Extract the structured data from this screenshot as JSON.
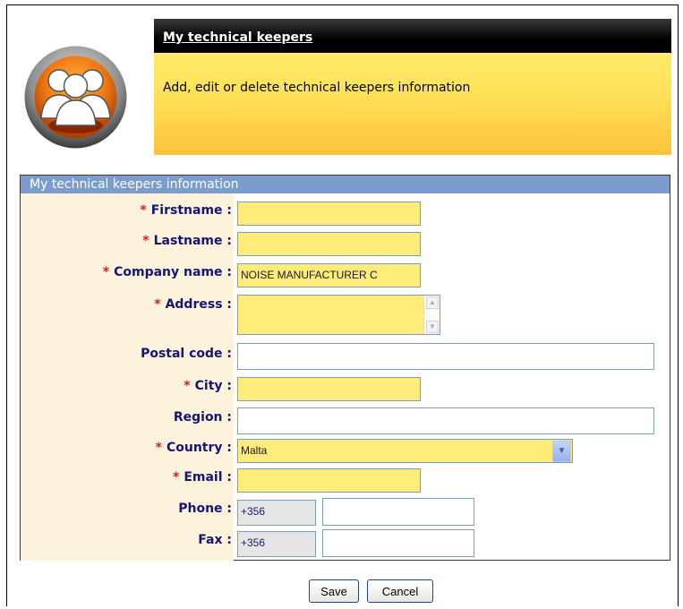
{
  "header": {
    "title": "My technical keepers",
    "description": "Add, edit or delete technical keepers information"
  },
  "panel": {
    "caption": "My technical keepers information"
  },
  "form": {
    "required_mark": "*",
    "firstname": {
      "label": "Firstname :",
      "value": ""
    },
    "lastname": {
      "label": "Lastname :",
      "value": ""
    },
    "company": {
      "label": "Company name :",
      "value": "NOISE MANUFACTURER C"
    },
    "address": {
      "label": "Address :",
      "value": ""
    },
    "postal_code": {
      "label": "Postal code :",
      "value": ""
    },
    "city": {
      "label": "City :",
      "value": ""
    },
    "region": {
      "label": "Region :",
      "value": ""
    },
    "country": {
      "label": "Country :",
      "value": "Malta"
    },
    "email": {
      "label": "Email :",
      "value": ""
    },
    "phone": {
      "label": "Phone :",
      "prefix": "+356",
      "value": ""
    },
    "fax": {
      "label": "Fax :",
      "prefix": "+356",
      "value": ""
    }
  },
  "buttons": {
    "save": "Save",
    "cancel": "Cancel"
  },
  "colors": {
    "required_field": "#ffec7b",
    "label_text": "#151576",
    "required_mark": "#d42020",
    "panel_caption": "#7b9ccc"
  },
  "icons": {
    "logo": "people-group-icon",
    "scroll_up": "arrow-up-icon",
    "scroll_down": "arrow-down-icon",
    "dropdown": "chevron-down-icon"
  }
}
